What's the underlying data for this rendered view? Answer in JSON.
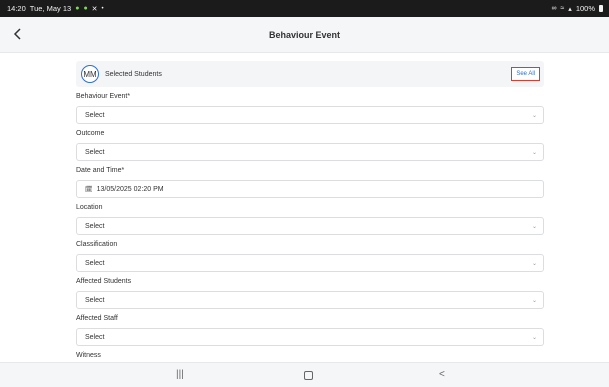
{
  "status_bar": {
    "time": "14:20",
    "date": "Tue, May 13",
    "battery": "100%",
    "icons": [
      "android-icon",
      "android-icon",
      "tools-icon",
      "dot-icon"
    ]
  },
  "header": {
    "title": "Behaviour Event"
  },
  "students": {
    "avatar": "MM",
    "label": "Selected Students",
    "see_all": "See All"
  },
  "fields": [
    {
      "label": "Behaviour Event*",
      "value": "Select"
    },
    {
      "label": "Outcome",
      "value": "Select"
    },
    {
      "label": "Date and Time*",
      "value": "13/05/2025 02:20 PM"
    },
    {
      "label": "Location",
      "value": "Select"
    },
    {
      "label": "Classification",
      "value": "Select"
    },
    {
      "label": "Affected Students",
      "value": "Select"
    },
    {
      "label": "Affected Staff",
      "value": "Select"
    },
    {
      "label": "Witness"
    }
  ],
  "nav": {
    "recent": "|||",
    "back": "<"
  },
  "colors": {
    "accent": "#2c6fd6",
    "highlight": "#e03a2f",
    "status_bar": "#1b1b1b"
  }
}
